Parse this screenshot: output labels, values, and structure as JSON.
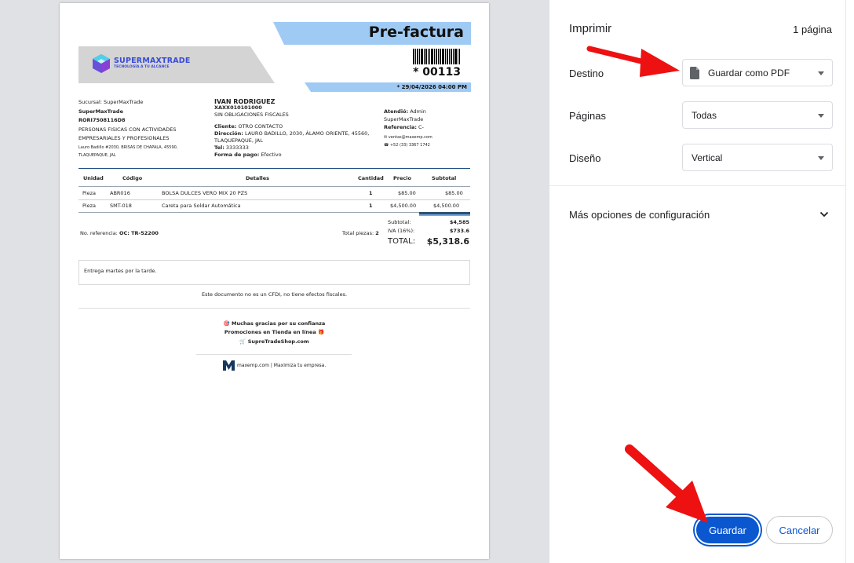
{
  "document": {
    "title": "Pre-factura",
    "logo": {
      "name": "SUPERMAXTRADE",
      "tagline": "TECNOLOGÍA A TU ALCANCE"
    },
    "folio": "* 00113",
    "date": "* 29/04/2026 04:00 PM",
    "branch": {
      "sucursal": "Sucursal: SuperMaxTrade",
      "company": "SuperMaxTrade",
      "rfc": "RORI7508116D8",
      "regime1": "PERSONAS FISICAS CON ACTIVIDADES",
      "regime2": "EMPRESARIALES Y PROFESIONALES",
      "address1": "Lauro Badillo #2030, BRISAS DE CHAPALA, 45590,",
      "address2": "TLAQUEPAQUE, JAL"
    },
    "client": {
      "name": "IVAN RODRIGUEZ",
      "rfc": "XAXX010101000",
      "regime": "SIN OBLIGACIONES FISCALES",
      "contact_label": "Cliente:",
      "contact_value": "OTRO CONTACTO",
      "address_label": "Dirección:",
      "address_value1": "LAURO BADILLO, 2030, ÁLAMO ORIENTE, 45560,",
      "address_value2": "TLAQUEPAQUE, JAL",
      "tel_label": "Tel:",
      "tel_value": "3333333",
      "payment_label": "Forma de pago:",
      "payment_value": "Efectivo"
    },
    "attended": {
      "label": "Atendió:",
      "value": "Admin",
      "company": "SuperMaxTrade",
      "ref_label": "Referencia:",
      "ref_value": "C-",
      "email": "ventas@maxemp.com",
      "phone": "+52 (33) 3367 1742"
    },
    "table": {
      "headers": [
        "Unidad",
        "Código",
        "Detalles",
        "Cantidad",
        "Precio",
        "Subtotal"
      ],
      "rows": [
        [
          "Pieza",
          "ABR016",
          "BOLSA DULCES VERO MIX 20 PZS",
          "1",
          "$85.00",
          "$85.00"
        ],
        [
          "Pieza",
          "SMT-018",
          "Careta para Soldar Automática",
          "1",
          "$4,500.00",
          "$4,500.00"
        ]
      ]
    },
    "reference_label": "No. referencia:",
    "reference_value": "OC: TR-52200",
    "pieces_label": "Total piezas:",
    "pieces_value": "2",
    "totals": {
      "subtotal_label": "Subtotal:",
      "subtotal_value": "$4,585",
      "iva_label": "IVA (16%):",
      "iva_value": "$733.6",
      "total_label": "TOTAL:",
      "total_value": "$5,318.6"
    },
    "notes": "Entrega martes por la tarde.",
    "disclaimer": "Este documento no es un CFDI, no tiene efectos fiscales.",
    "thanks": "🎯 Muchas gracias por su confianza",
    "promo": "Promociones en Tienda en línea 🎁",
    "shop": "🛒 SupreTradeShop.com",
    "footer": "maxemp.com | Maximiza tu empresa."
  },
  "dialog": {
    "title": "Imprimir",
    "page_count": "1 página",
    "destination_label": "Destino",
    "destination_value": "Guardar como PDF",
    "pages_label": "Páginas",
    "pages_value": "Todas",
    "layout_label": "Diseño",
    "layout_value": "Vertical",
    "more_options": "Más opciones de configuración",
    "save_button": "Guardar",
    "cancel_button": "Cancelar"
  },
  "colors": {
    "accent_blue": "#0b57d0",
    "band_blue": "#9fcaf4",
    "arrow_red": "#ee1111"
  },
  "icons": [
    "pdf-file-icon",
    "dropdown-caret-icon",
    "chevron-down-icon",
    "envelope-icon",
    "phone-icon",
    "maxemp-logo-icon",
    "supermaxtrade-cube-icon",
    "barcode"
  ]
}
